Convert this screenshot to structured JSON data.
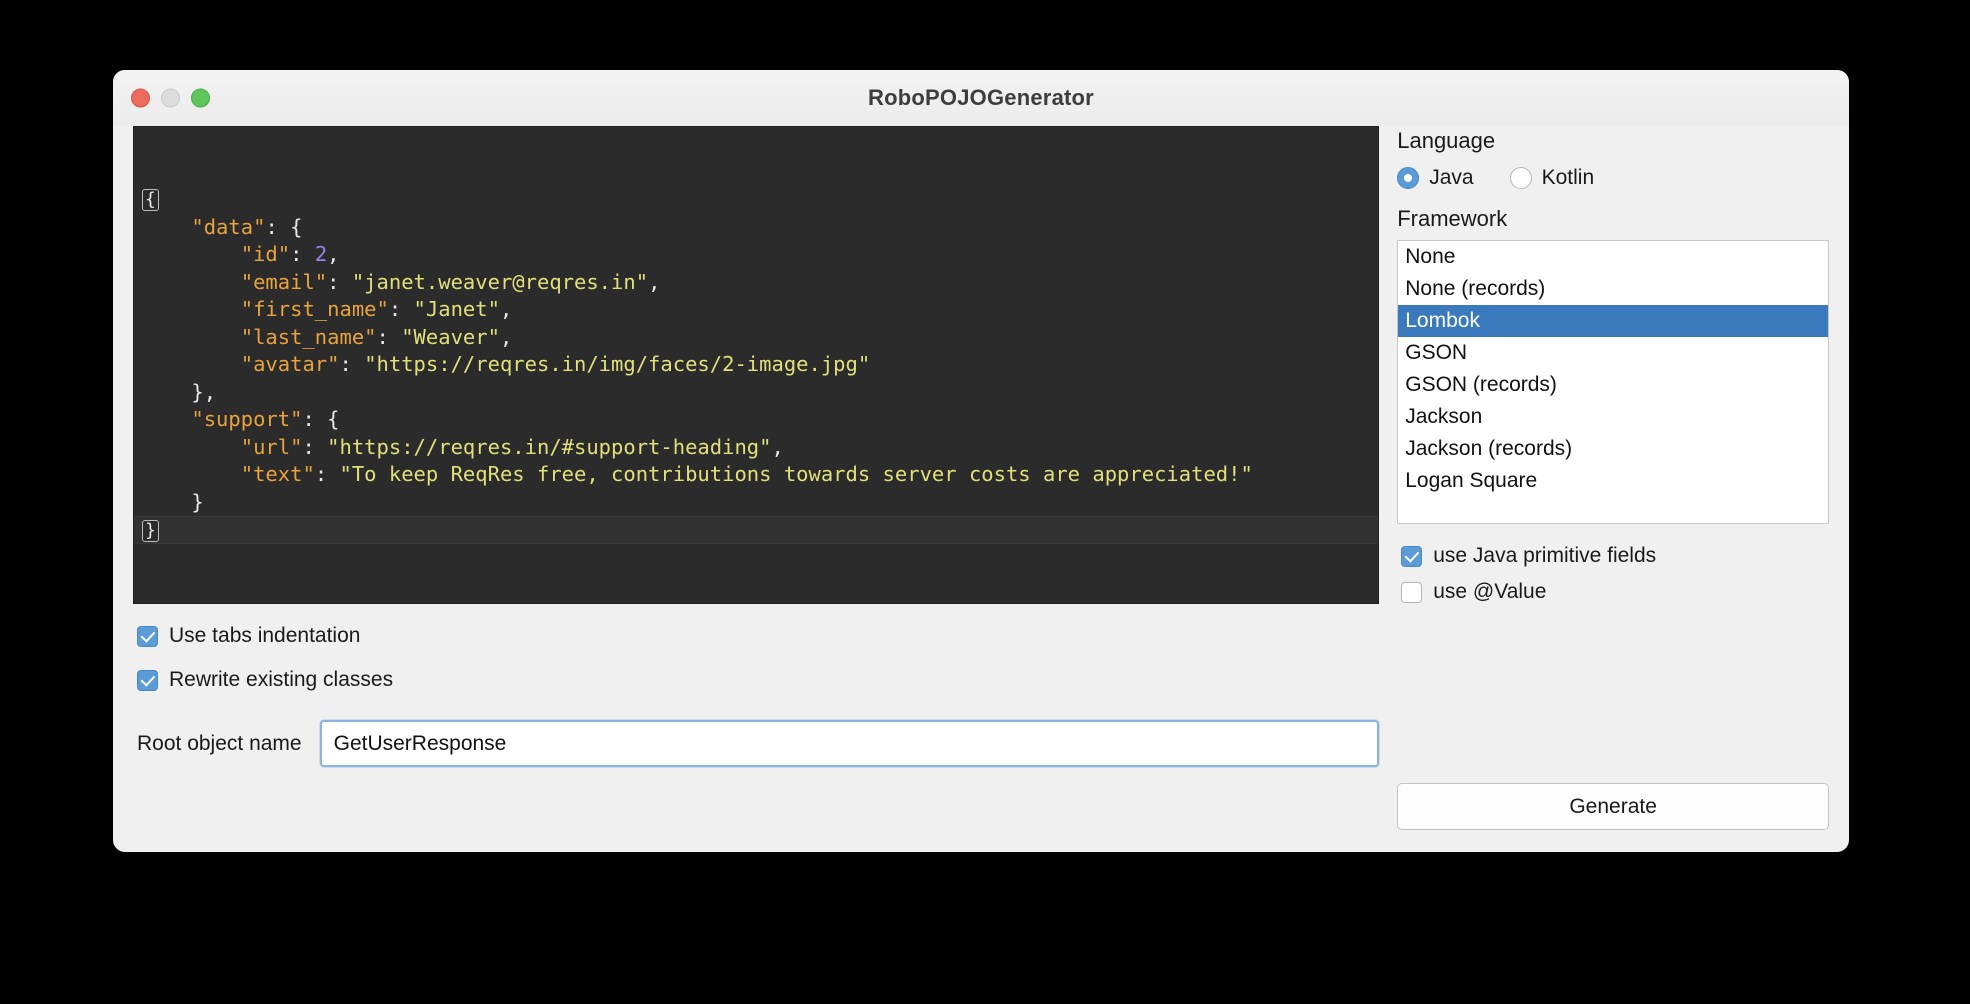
{
  "window": {
    "title": "RoboPOJOGenerator",
    "traffic_lights": {
      "close": "close-button",
      "minimize": "minimize-button",
      "maximize": "maximize-button"
    }
  },
  "editor": {
    "name": "json-input-editor",
    "fold_open": "{",
    "fold_close": "}",
    "lines": [
      {
        "indent": 1,
        "key": "\"data\"",
        "sep": ": ",
        "value": "{",
        "value_type": "brace"
      },
      {
        "indent": 2,
        "key": "\"id\"",
        "sep": ": ",
        "value": "2",
        "value_type": "num",
        "trail": ","
      },
      {
        "indent": 2,
        "key": "\"email\"",
        "sep": ": ",
        "value": "\"janet.weaver@reqres.in\"",
        "value_type": "str",
        "trail": ","
      },
      {
        "indent": 2,
        "key": "\"first_name\"",
        "sep": ": ",
        "value": "\"Janet\"",
        "value_type": "str",
        "trail": ","
      },
      {
        "indent": 2,
        "key": "\"last_name\"",
        "sep": ": ",
        "value": "\"Weaver\"",
        "value_type": "str",
        "trail": ","
      },
      {
        "indent": 2,
        "key": "\"avatar\"",
        "sep": ": ",
        "value": "\"https://reqres.in/img/faces/2-image.jpg\"",
        "value_type": "str",
        "trail": ""
      },
      {
        "indent": 1,
        "key": "",
        "sep": "",
        "value": "}",
        "value_type": "brace",
        "trail": ","
      },
      {
        "indent": 1,
        "key": "\"support\"",
        "sep": ": ",
        "value": "{",
        "value_type": "brace"
      },
      {
        "indent": 2,
        "key": "\"url\"",
        "sep": ": ",
        "value": "\"https://reqres.in/#support-heading\"",
        "value_type": "str",
        "trail": ","
      },
      {
        "indent": 2,
        "key": "\"text\"",
        "sep": ": ",
        "value": "\"To keep ReqRes free, contributions towards server costs are appreciated!\"",
        "value_type": "str",
        "trail": ""
      },
      {
        "indent": 1,
        "key": "",
        "sep": "",
        "value": "}",
        "value_type": "brace",
        "trail": ""
      }
    ]
  },
  "left_options": {
    "use_tabs": {
      "label": "Use tabs indentation",
      "checked": true
    },
    "rewrite_existing": {
      "label": "Rewrite existing classes",
      "checked": true
    }
  },
  "root_object": {
    "label": "Root object name",
    "value": "GetUserResponse",
    "placeholder": "Root object name"
  },
  "language": {
    "title": "Language",
    "options": [
      {
        "label": "Java",
        "selected": true
      },
      {
        "label": "Kotlin",
        "selected": false
      }
    ]
  },
  "framework": {
    "title": "Framework",
    "items": [
      {
        "label": "None",
        "selected": false
      },
      {
        "label": "None (records)",
        "selected": false
      },
      {
        "label": "Lombok",
        "selected": true
      },
      {
        "label": "GSON",
        "selected": false
      },
      {
        "label": "GSON (records)",
        "selected": false
      },
      {
        "label": "Jackson",
        "selected": false
      },
      {
        "label": "Jackson (records)",
        "selected": false
      },
      {
        "label": "Logan Square",
        "selected": false
      }
    ]
  },
  "right_options": {
    "primitive_fields": {
      "label": "use Java primitive fields",
      "checked": true
    },
    "use_value": {
      "label": "use @Value",
      "checked": false
    }
  },
  "actions": {
    "generate": "Generate"
  },
  "colors": {
    "accent": "#5b9bd8",
    "selection": "#3b79bd",
    "editor_bg": "#2b2b2b",
    "key": "#e8a33d",
    "string": "#dfe07a",
    "number": "#9a7fee",
    "window_bg": "#f0f0f0"
  }
}
